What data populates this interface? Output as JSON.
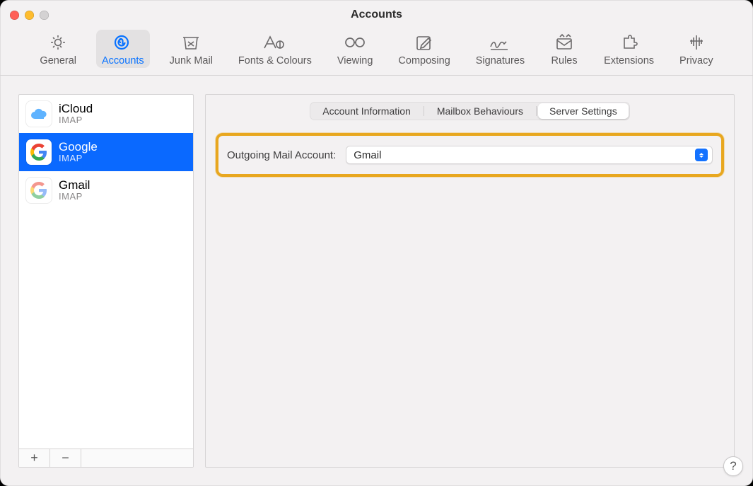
{
  "window": {
    "title": "Accounts"
  },
  "toolbar": {
    "items": [
      {
        "name": "general",
        "icon": "general-icon",
        "label": "General"
      },
      {
        "name": "accounts",
        "icon": "accounts-icon",
        "label": "Accounts",
        "selected": true
      },
      {
        "name": "junk",
        "icon": "junk-mail-icon",
        "label": "Junk Mail"
      },
      {
        "name": "fonts",
        "icon": "fonts-colours-icon",
        "label": "Fonts & Colours"
      },
      {
        "name": "viewing",
        "icon": "viewing-icon",
        "label": "Viewing"
      },
      {
        "name": "composing",
        "icon": "composing-icon",
        "label": "Composing"
      },
      {
        "name": "signatures",
        "icon": "signatures-icon",
        "label": "Signatures"
      },
      {
        "name": "rules",
        "icon": "rules-icon",
        "label": "Rules"
      },
      {
        "name": "extensions",
        "icon": "extensions-icon",
        "label": "Extensions"
      },
      {
        "name": "privacy",
        "icon": "privacy-icon",
        "label": "Privacy"
      }
    ]
  },
  "sidebar": {
    "accounts": [
      {
        "name": "iCloud",
        "subtype": "IMAP",
        "icon": "icloud"
      },
      {
        "name": "Google",
        "subtype": "IMAP",
        "icon": "google",
        "selected": true
      },
      {
        "name": "Gmail",
        "subtype": "IMAP",
        "icon": "gmail"
      }
    ],
    "footer": {
      "add": "+",
      "remove": "−"
    }
  },
  "pane": {
    "tabs": [
      {
        "label": "Account Information"
      },
      {
        "label": "Mailbox Behaviours"
      },
      {
        "label": "Server Settings",
        "active": true
      }
    ],
    "outgoing": {
      "label": "Outgoing Mail Account:",
      "value": "Gmail"
    }
  },
  "help": {
    "label": "?"
  }
}
